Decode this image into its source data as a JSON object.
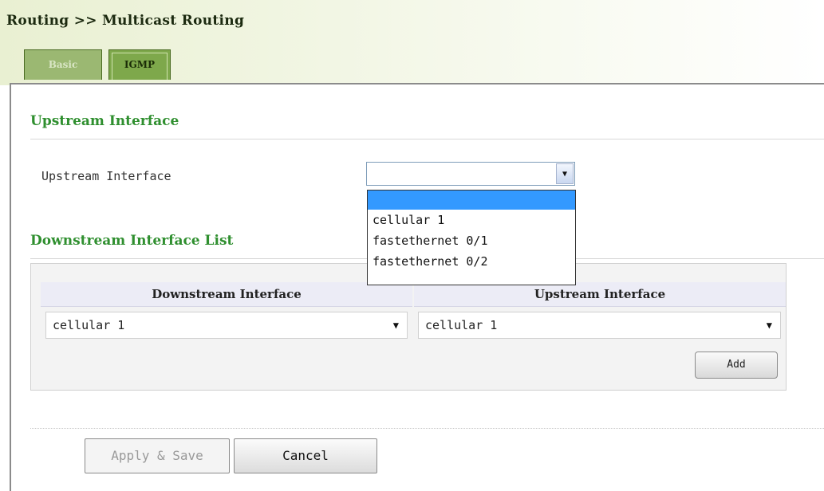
{
  "breadcrumb": "Routing >> Multicast Routing",
  "tabs": [
    {
      "label": "Basic",
      "active": false
    },
    {
      "label": "IGMP",
      "active": true
    }
  ],
  "upstream_section": {
    "title": "Upstream Interface",
    "field_label": "Upstream Interface",
    "selected_value": "",
    "options": [
      "",
      "cellular 1",
      "fastethernet 0/1",
      "fastethernet 0/2"
    ]
  },
  "downstream_section": {
    "title": "Downstream Interface List",
    "columns": [
      "Downstream Interface",
      "Upstream Interface"
    ],
    "downstream_value": "cellular 1",
    "upstream_value": "cellular 1",
    "add_label": "Add"
  },
  "footer": {
    "apply_label": "Apply & Save",
    "cancel_label": "Cancel"
  },
  "colors": {
    "section_title": "#2f8f2f",
    "tab_active": "#7ea84b",
    "tab_inactive": "#9bb872",
    "dropdown_highlight": "#3399ff"
  },
  "icons": {
    "dropdown_arrow": "chevron-down-icon"
  }
}
